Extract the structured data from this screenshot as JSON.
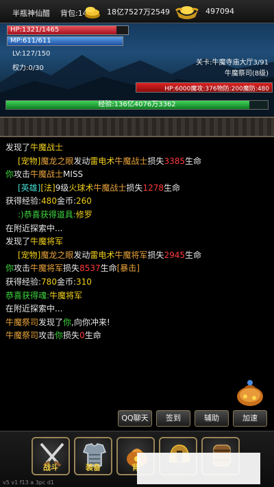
{
  "header": {
    "player_name": "半瓶神仙醋",
    "bag_label": "背包:142",
    "gold_amount": "18亿7527万2549",
    "ingot_amount": "497094"
  },
  "player": {
    "hp_text": "HP:1321/1465",
    "hp_fraction": 0.9017,
    "mp_text": "MP:611/611",
    "mp_fraction": 1.0,
    "level_text": "LV:127/150",
    "power_text": "权力:0/30"
  },
  "stage": {
    "name": "关卡:牛魔寺庙大厅3/91",
    "monster_name": "牛魔祭司(8级)",
    "monster_stats": "HP:6000魔攻:376物防:200魔防:480"
  },
  "exp": {
    "text": "经验:136亿4076万3362",
    "fraction": 0.93
  },
  "log": [
    [
      {
        "t": "发现了",
        "c": "w"
      },
      {
        "t": "牛魔战士",
        "c": "y"
      }
    ],
    [
      {
        "t": "[宠物]",
        "c": "y",
        "indent": true
      },
      {
        "t": "魔龙之眼",
        "c": "o"
      },
      {
        "t": "发动",
        "c": "w"
      },
      {
        "t": "雷电术",
        "c": "y"
      },
      {
        "t": "牛魔战士",
        "c": "o"
      },
      {
        "t": "损失",
        "c": "w"
      },
      {
        "t": "3385",
        "c": "r"
      },
      {
        "t": "生命",
        "c": "w"
      }
    ],
    [
      {
        "t": "你",
        "c": "g"
      },
      {
        "t": "攻击",
        "c": "w"
      },
      {
        "t": "牛魔战士",
        "c": "o"
      },
      {
        "t": "MISS",
        "c": "w"
      }
    ],
    [
      {
        "t": "[英雄]",
        "c": "c",
        "indent": true
      },
      {
        "t": "[法]",
        "c": "y"
      },
      {
        "t": "9级",
        "c": "w"
      },
      {
        "t": "火球术",
        "c": "y"
      },
      {
        "t": "牛魔战士",
        "c": "o"
      },
      {
        "t": "损失",
        "c": "w"
      },
      {
        "t": "1278",
        "c": "r"
      },
      {
        "t": "生命",
        "c": "w"
      }
    ],
    [
      {
        "t": "获得经验:",
        "c": "w"
      },
      {
        "t": "480",
        "c": "y"
      },
      {
        "t": "金币:",
        "c": "w"
      },
      {
        "t": "260",
        "c": "y"
      }
    ],
    [
      {
        "t": ":)恭喜获得道具:",
        "c": "g",
        "indent": true
      },
      {
        "t": "修罗",
        "c": "y"
      }
    ],
    [
      {
        "t": "在附近探索中...",
        "c": "w"
      }
    ],
    [
      {
        "t": "发现了",
        "c": "w"
      },
      {
        "t": "牛魔将军",
        "c": "y"
      }
    ],
    [
      {
        "t": "[宠物]",
        "c": "y",
        "indent": true
      },
      {
        "t": "魔龙之眼",
        "c": "o"
      },
      {
        "t": "发动",
        "c": "w"
      },
      {
        "t": "雷电术",
        "c": "y"
      },
      {
        "t": "牛魔将军",
        "c": "o"
      },
      {
        "t": "损失",
        "c": "w"
      },
      {
        "t": "2945",
        "c": "r"
      },
      {
        "t": "生命",
        "c": "w"
      }
    ],
    [
      {
        "t": "你",
        "c": "g"
      },
      {
        "t": "攻击",
        "c": "w"
      },
      {
        "t": "牛魔将军",
        "c": "o"
      },
      {
        "t": "损失",
        "c": "w"
      },
      {
        "t": "8537",
        "c": "r"
      },
      {
        "t": "生命",
        "c": "w"
      },
      {
        "t": "[暴击]",
        "c": "o"
      }
    ],
    [
      {
        "t": "获得经验:",
        "c": "w"
      },
      {
        "t": "780",
        "c": "y"
      },
      {
        "t": "金币:",
        "c": "w"
      },
      {
        "t": "310",
        "c": "y"
      }
    ],
    [
      {
        "t": "恭喜获得魂:",
        "c": "g"
      },
      {
        "t": "牛魔将军",
        "c": "y"
      }
    ],
    [
      {
        "t": "在附近探索中...",
        "c": "w"
      }
    ],
    [
      {
        "t": "牛魔祭司",
        "c": "o"
      },
      {
        "t": "发现了",
        "c": "w"
      },
      {
        "t": "你",
        "c": "g"
      },
      {
        "t": ",向你冲来!",
        "c": "w"
      }
    ],
    [
      {
        "t": "牛魔祭司",
        "c": "o"
      },
      {
        "t": "攻击",
        "c": "w"
      },
      {
        "t": "你",
        "c": "g"
      },
      {
        "t": "损失",
        "c": "w"
      },
      {
        "t": "0",
        "c": "r"
      },
      {
        "t": "生命",
        "c": "w"
      }
    ]
  ],
  "actions": {
    "qq_chat": "QQ聊天",
    "sign_in": "签到",
    "assist": "辅助",
    "speed_up": "加速"
  },
  "nav": {
    "battle": "战斗",
    "equipment": "装备",
    "bag": "背"
  },
  "footer": {
    "version": "v5 v1 f13 a 3pc d1"
  },
  "icons": {
    "gold": "coin-pile-icon",
    "ingot": "gold-ingot-icon",
    "bag": "treasure-bag-icon",
    "battle": "crossed-swords-icon",
    "equipment": "armor-icon",
    "bag_nav": "bag-icon",
    "helmet": "helmet-icon",
    "barrel": "barrel-icon"
  }
}
